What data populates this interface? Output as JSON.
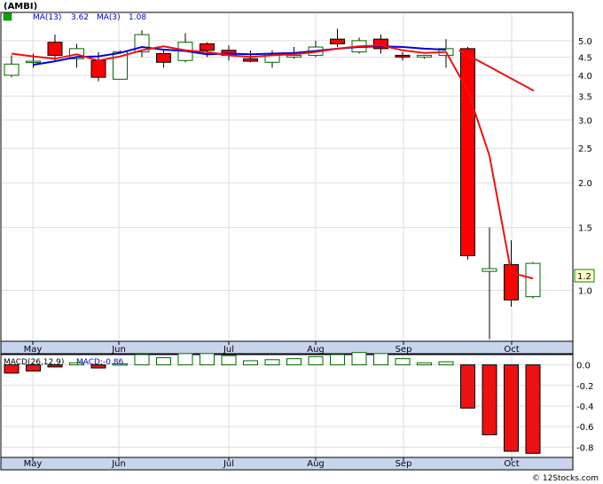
{
  "chart_data": [
    {
      "type": "candlestick",
      "title": "(AMBI)",
      "scale": "log",
      "ylim": [
        0.72,
        6.0
      ],
      "ticks": [
        1.0,
        1.5,
        2.0,
        2.5,
        3.0,
        3.5,
        4.0,
        4.5,
        5.0
      ],
      "tick_labels": [
        "1.0",
        "1.5",
        "2.0",
        "2.5",
        "3.0",
        "3.5",
        "4.0",
        "4.5",
        "5.0"
      ],
      "months": [
        "May",
        "Jun",
        "Jul",
        "Aug",
        "Sep",
        "Oct"
      ],
      "legend": [
        {
          "label": "MA(13)",
          "value": "3.62",
          "color": "#0000cc"
        },
        {
          "label": "MA(3)",
          "value": "1.08",
          "color": "#0000cc"
        }
      ],
      "last_price_label": "1.2",
      "up_color": "#00aa00",
      "down_color": "#ff0000",
      "ma13_color": "#0000dd",
      "ma3_color": "#ee1111",
      "candles": [
        {
          "o": 4.0,
          "h": 4.55,
          "l": 3.95,
          "c": 4.3
        },
        {
          "o": 4.35,
          "h": 4.6,
          "l": 4.2,
          "c": 4.38
        },
        {
          "o": 4.95,
          "h": 5.2,
          "l": 4.4,
          "c": 4.55
        },
        {
          "o": 4.45,
          "h": 4.9,
          "l": 4.2,
          "c": 4.75
        },
        {
          "o": 4.4,
          "h": 4.65,
          "l": 3.85,
          "c": 3.95
        },
        {
          "o": 3.9,
          "h": 4.7,
          "l": 3.9,
          "c": 4.65
        },
        {
          "o": 4.65,
          "h": 5.35,
          "l": 4.5,
          "c": 5.2
        },
        {
          "o": 4.6,
          "h": 4.7,
          "l": 4.2,
          "c": 4.35
        },
        {
          "o": 4.4,
          "h": 5.25,
          "l": 4.35,
          "c": 4.95
        },
        {
          "o": 4.9,
          "h": 4.95,
          "l": 4.5,
          "c": 4.7
        },
        {
          "o": 4.7,
          "h": 4.85,
          "l": 4.4,
          "c": 4.55
        },
        {
          "o": 4.45,
          "h": 4.7,
          "l": 4.35,
          "c": 4.38
        },
        {
          "o": 4.35,
          "h": 4.7,
          "l": 4.2,
          "c": 4.6
        },
        {
          "o": 4.5,
          "h": 4.8,
          "l": 4.45,
          "c": 4.55
        },
        {
          "o": 4.55,
          "h": 5.0,
          "l": 4.5,
          "c": 4.8
        },
        {
          "o": 5.05,
          "h": 5.4,
          "l": 4.8,
          "c": 4.9
        },
        {
          "o": 4.65,
          "h": 5.1,
          "l": 4.6,
          "c": 5.0
        },
        {
          "o": 5.05,
          "h": 5.2,
          "l": 4.6,
          "c": 4.75
        },
        {
          "o": 4.55,
          "h": 4.65,
          "l": 4.4,
          "c": 4.5
        },
        {
          "o": 4.5,
          "h": 4.55,
          "l": 4.45,
          "c": 4.55
        },
        {
          "o": 4.55,
          "h": 5.05,
          "l": 4.2,
          "c": 4.75
        },
        {
          "o": 4.75,
          "h": 4.8,
          "l": 1.22,
          "c": 1.25
        },
        {
          "o": 1.13,
          "h": 1.5,
          "l": 0.73,
          "c": 1.15
        },
        {
          "o": 1.18,
          "h": 1.38,
          "l": 0.9,
          "c": 0.94
        },
        {
          "o": 0.96,
          "h": 1.2,
          "l": 0.95,
          "c": 1.19
        }
      ],
      "ma13": [
        null,
        4.28,
        4.38,
        4.5,
        4.52,
        4.62,
        4.8,
        4.72,
        4.68,
        4.58,
        4.6,
        4.58,
        4.6,
        4.62,
        4.68,
        4.75,
        4.8,
        4.82,
        4.8,
        4.75,
        4.72
      ],
      "ma3": [
        4.6,
        4.52,
        4.45,
        4.58,
        4.4,
        4.52,
        4.7,
        4.82,
        4.7,
        4.65,
        4.55,
        4.5,
        4.55,
        4.58,
        4.65,
        4.75,
        4.82,
        4.85,
        4.7,
        4.62,
        4.65,
        3.62,
        2.38,
        1.12,
        1.08,
        null,
        3.62
      ]
    },
    {
      "type": "bar",
      "title": "MACD(26,12,9)",
      "macd_label": "MACD:-0.86",
      "ylim": [
        -0.9,
        0.1
      ],
      "ticks": [
        0.0,
        -0.2,
        -0.4,
        -0.6,
        -0.8
      ],
      "tick_labels": [
        "0.0",
        "-0.2",
        "-0.4",
        "-0.6",
        "-0.8"
      ],
      "months": [
        "May",
        "Jun",
        "Jul",
        "Aug",
        "Sep",
        "Oct"
      ],
      "values": [
        -0.08,
        -0.06,
        -0.02,
        0.02,
        -0.03,
        0.01,
        0.1,
        0.07,
        0.11,
        0.11,
        0.09,
        0.04,
        0.05,
        0.06,
        0.08,
        0.1,
        0.12,
        0.11,
        0.06,
        0.02,
        0.03,
        -0.42,
        -0.68,
        -0.84,
        -0.86
      ]
    }
  ],
  "footer": {
    "copyright": "© 12Stocks.com"
  }
}
